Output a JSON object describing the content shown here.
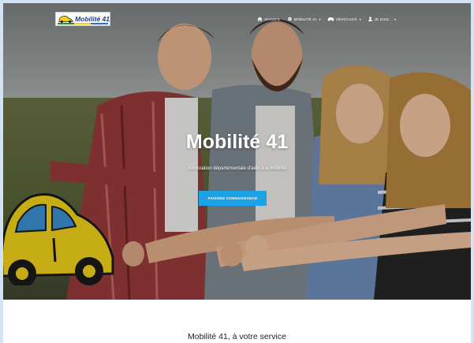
{
  "nav": {
    "logo_text": "Mobilité 41",
    "items": [
      {
        "label": "ACCUEIL",
        "icon": "home-icon",
        "has_caret": false
      },
      {
        "label": "MOBILITÉ 41",
        "icon": "gear-icon",
        "has_caret": true
      },
      {
        "label": "VÉHICULES",
        "icon": "car-icon",
        "has_caret": true
      },
      {
        "label": "JE SUIS...",
        "icon": "user-icon",
        "has_caret": true
      }
    ]
  },
  "hero": {
    "title": "Mobilité 41",
    "subtitle": "Association départementale d'aide à la mobilité",
    "cta_label": "FAISONS CONNAISSANCE"
  },
  "section": {
    "title": "Mobilité 41, à votre service"
  },
  "colors": {
    "page_bg": "#d3e3f7",
    "accent": "#1ba3e5",
    "logo_blue": "#1b3c86",
    "car_yellow": "#f2d31a"
  }
}
